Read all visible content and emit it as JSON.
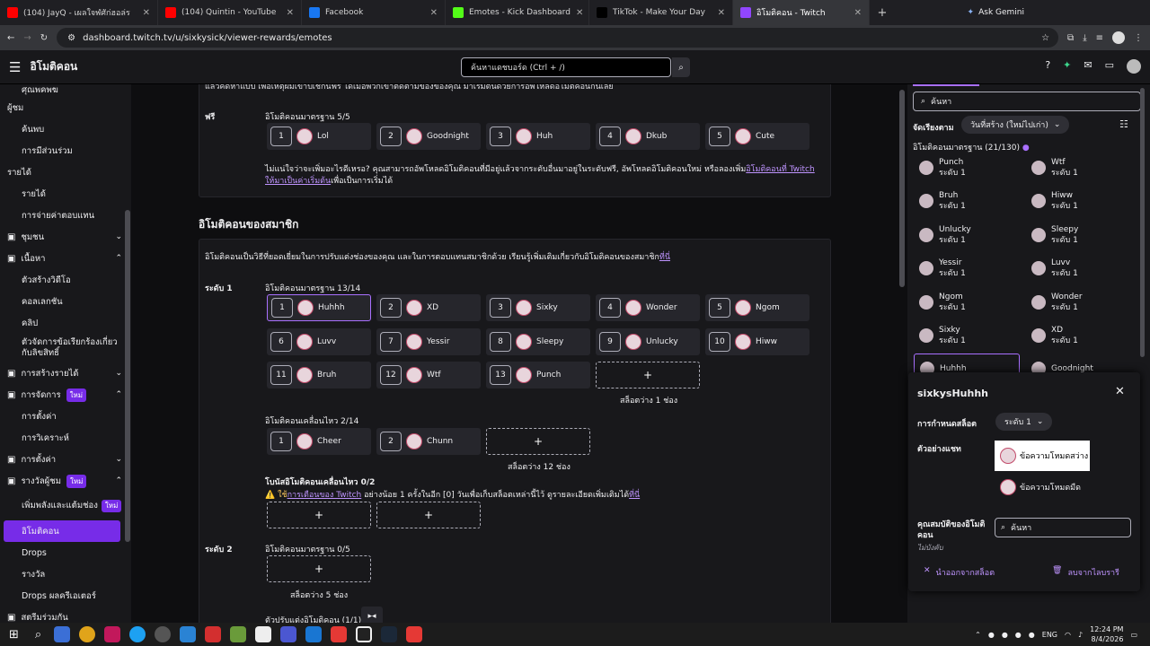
{
  "tabs": [
    {
      "label": "(104) JayQ - เผลใจฬศัก่ฮอล่ร",
      "color": "#ff0000"
    },
    {
      "label": "(104) Quintin - YouTube",
      "color": "#ff0000"
    },
    {
      "label": "Facebook",
      "color": "#1877f2"
    },
    {
      "label": "Emotes - Kick Dashboard",
      "color": "#53fc18"
    },
    {
      "label": "TikTok - Make Your Day",
      "color": "#000000"
    },
    {
      "label": "อิโมติคอน - Twitch",
      "color": "#9146ff"
    }
  ],
  "ask_gemini": "Ask Gemini",
  "url": "dashboard.twitch.tv/u/sixkysick/viewer-rewards/emotes",
  "header": {
    "title": "อิโมติคอน",
    "search_placeholder": "ค้นหาแดชบอร์ด (Ctrl + /)"
  },
  "sidebar": {
    "items": [
      {
        "type": "sub",
        "label": "ศุณพคพฆ"
      },
      {
        "type": "head",
        "label": "ผู้ชม",
        "icon": ""
      },
      {
        "type": "sub",
        "label": "ค้นพบ"
      },
      {
        "type": "sub",
        "label": "การมีส่วนร่วม"
      },
      {
        "type": "head",
        "label": "รายได้",
        "icon": ""
      },
      {
        "type": "sub",
        "label": "รายได้"
      },
      {
        "type": "sub",
        "label": "การจ่ายค่าตอบแทน"
      },
      {
        "type": "head",
        "label": "ชุมชน",
        "icon": "community-icon",
        "chev": "⌄"
      },
      {
        "type": "head",
        "label": "เนื้อหา",
        "icon": "content-icon",
        "chev": "⌃"
      },
      {
        "type": "sub",
        "label": "ตัวสร้างวิดีโอ"
      },
      {
        "type": "sub",
        "label": "คอลเลกชัน"
      },
      {
        "type": "sub",
        "label": "คลิป"
      },
      {
        "type": "sub2",
        "label": "ตัวจัดการข้อเรียกร้องเกี่ยวกับลิขสิทธิ์"
      },
      {
        "type": "head",
        "label": "การสร้างรายได้",
        "icon": "money-icon",
        "chev": "⌄"
      },
      {
        "type": "head",
        "label": "การจัดการ",
        "icon": "wrench-icon",
        "chev": "⌃",
        "badge": "ใหม่"
      },
      {
        "type": "sub",
        "label": "การตั้งค่า"
      },
      {
        "type": "sub",
        "label": "การวิเคราะห์"
      },
      {
        "type": "head",
        "label": "การตั้งค่า",
        "icon": "gear-icon",
        "chev": "⌄"
      },
      {
        "type": "head",
        "label": "รางวัลผู้ชม",
        "icon": "reward-icon",
        "chev": "⌃",
        "badge": "ใหม่"
      },
      {
        "type": "sub2",
        "label": "เพิ่มพลังและแต้มช่อง",
        "badge": "ใหม่"
      },
      {
        "type": "sel",
        "label": "อิโมติคอน"
      },
      {
        "type": "sub",
        "label": "Drops"
      },
      {
        "type": "sub",
        "label": "รางวัล"
      },
      {
        "type": "sub",
        "label": "Drops ผลครีเอเตอร์"
      },
      {
        "type": "head",
        "label": "สตรีมร่วมกัน",
        "icon": "stream-icon"
      }
    ]
  },
  "main": {
    "intro": "แล้วคิดหาแบบ เพื่อเหตุผมเข้าปเชกนฟรี ได้เมื่อพวกเขาติดตามของของคุณ มาเริ่มต้นด้วยการอัพโหลดอิโมติคอนกันเลย",
    "free_label": "ฟรี",
    "free_std_label": "อิโมติคอนมาตรฐาน 5/5",
    "free_slots": [
      {
        "n": "1",
        "name": "Lol"
      },
      {
        "n": "2",
        "name": "Goodnight"
      },
      {
        "n": "3",
        "name": "Huh"
      },
      {
        "n": "4",
        "name": "Dkub"
      },
      {
        "n": "5",
        "name": "Cute"
      }
    ],
    "free_note": "ไม่แน่ใจว่าจะเพิ่มอะไรดีเหรอ? คุณสามารถอัพโหลดอิโมติคอนที่มีอยู่แล้วจากระดับอื่นมาอยู่ในระดับฟรี, อัพโหลดอิโมติคอนใหม่ หรือลองเพิ่ม",
    "free_note_link": "อิโมติคอนที่ Twitch ให้มาเป็นค่าเริ่มต้น",
    "free_note_end": "เพื่อเป็นการเริ่มได้",
    "sub_title": "อิโมติคอนของสมาชิก",
    "sub_desc": "อิโมติคอนเป็นวิธีที่ยอดเยี่ยมในการปรับแต่งช่องของคุณ และในการตอบแทนสมาชิกด้วย เรียนรู้เพิ่มเติมเกี่ยวกับอิโมติคอนของสมาชิก",
    "sub_desc_link": "ที่นี่",
    "tier1_label": "ระดับ 1",
    "tier1_std_label": "อิโมติคอนมาตรฐาน 13/14",
    "tier1_slots": [
      {
        "n": "1",
        "name": "Huhhh"
      },
      {
        "n": "2",
        "name": "XD"
      },
      {
        "n": "3",
        "name": "Sixky"
      },
      {
        "n": "4",
        "name": "Wonder"
      },
      {
        "n": "5",
        "name": "Ngom"
      },
      {
        "n": "6",
        "name": "Luvv"
      },
      {
        "n": "7",
        "name": "Yessir"
      },
      {
        "n": "8",
        "name": "Sleepy"
      },
      {
        "n": "9",
        "name": "Unlucky"
      },
      {
        "n": "10",
        "name": "Hiww"
      },
      {
        "n": "11",
        "name": "Bruh"
      },
      {
        "n": "12",
        "name": "Wtf"
      },
      {
        "n": "13",
        "name": "Punch"
      }
    ],
    "tier1_empty": "สล็อตว่าง 1 ช่อง",
    "tier1_anim_label": "อิโมติคอนเคลื่อนไหว 2/14",
    "tier1_anim_slots": [
      {
        "n": "1",
        "name": "Cheer"
      },
      {
        "n": "2",
        "name": "Chunn"
      }
    ],
    "tier1_anim_empty": "สล็อตว่าง 12 ช่อง",
    "bonus_label": "โบนัสอิโมติคอนเคลื่อนไหว 0/2",
    "bonus_warn_a": "⚠️ ใช้",
    "bonus_link": "การเตือนของ Twitch",
    "bonus_warn_b": " อย่างน้อย 1 ครั้งในอีก [0] วันเพื่อเก็บสล็อตเหล่านี้ไว้ ดูรายละเอียดเพิ่มเติมได้",
    "bonus_link2": "ที่นี่",
    "tier2_label": "ระดับ 2",
    "tier2_std_label": "อิโมติคอนมาตรฐาน 0/5",
    "tier2_empty": "สล็อตว่าง 5 ช่อง",
    "customizer_label": "ตัวปรับแต่งอิโมติคอน (1/1)"
  },
  "right": {
    "search": "ค้นหา",
    "sort_label": "จัดเรียงตาม",
    "sort_value": "วันที่สร้าง (ใหม่ไปเก่า)",
    "std_label": "อิโมติคอนมาตรฐาน (21/130)",
    "items": [
      {
        "name": "Punch",
        "tier": "ระดับ 1"
      },
      {
        "name": "Wtf",
        "tier": "ระดับ 1"
      },
      {
        "name": "Bruh",
        "tier": "ระดับ 1"
      },
      {
        "name": "Hiww",
        "tier": "ระดับ 1"
      },
      {
        "name": "Unlucky",
        "tier": "ระดับ 1"
      },
      {
        "name": "Sleepy",
        "tier": "ระดับ 1"
      },
      {
        "name": "Yessir",
        "tier": "ระดับ 1"
      },
      {
        "name": "Luvv",
        "tier": "ระดับ 1"
      },
      {
        "name": "Ngom",
        "tier": "ระดับ 1"
      },
      {
        "name": "Wonder",
        "tier": "ระดับ 1"
      },
      {
        "name": "Sixky",
        "tier": "ระดับ 1"
      },
      {
        "name": "XD",
        "tier": "ระดับ 1"
      },
      {
        "name": "Huhhh",
        "tier": ""
      },
      {
        "name": "Goodnight",
        "tier": ""
      }
    ]
  },
  "modal": {
    "title": "sixkysHuhhh",
    "slot_label": "การกำหนดสล็อต",
    "slot_value": "ระดับ 1",
    "preview_label": "ตัวอย่างแชท",
    "preview_light": "ข้อความโหมดสว่าง",
    "preview_dark": "ข้อความโหมดมืด",
    "collab_label": "คุณสมบัติของอิโมติคอน",
    "collab_sub": "ไม่บังคับ",
    "collab_search": "ค้นหา",
    "remove_slot": "นำออกจากสล็อต",
    "delete_lib": "ลบจากไลบรารี"
  },
  "taskbar": {
    "lang": "ENG",
    "time": "12:24 PM",
    "date": "8/4/2026"
  }
}
